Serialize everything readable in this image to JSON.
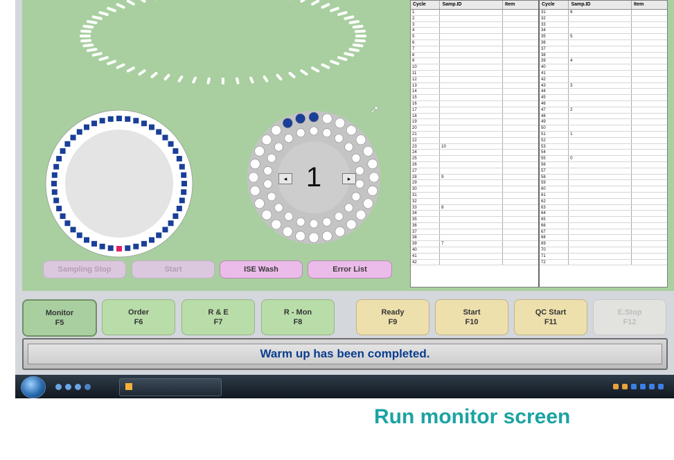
{
  "table": {
    "columns": [
      "Cycle",
      "Samp.ID",
      "Item"
    ],
    "left_rows": [
      [
        "1",
        ""
      ],
      [
        "2",
        ""
      ],
      [
        "3",
        ""
      ],
      [
        "4",
        ""
      ],
      [
        "5",
        ""
      ],
      [
        "6",
        ""
      ],
      [
        "7",
        ""
      ],
      [
        "8",
        ""
      ],
      [
        "9",
        ""
      ],
      [
        "10",
        ""
      ],
      [
        "11",
        ""
      ],
      [
        "12",
        ""
      ],
      [
        "13",
        ""
      ],
      [
        "14",
        ""
      ],
      [
        "15",
        ""
      ],
      [
        "16",
        ""
      ],
      [
        "17",
        ""
      ],
      [
        "18",
        ""
      ],
      [
        "19",
        ""
      ],
      [
        "20",
        ""
      ],
      [
        "21",
        ""
      ],
      [
        "22",
        ""
      ],
      [
        "23",
        "10"
      ],
      [
        "24",
        ""
      ],
      [
        "25",
        ""
      ],
      [
        "26",
        ""
      ],
      [
        "27",
        ""
      ],
      [
        "28",
        "9"
      ],
      [
        "29",
        ""
      ],
      [
        "30",
        ""
      ],
      [
        "31",
        ""
      ],
      [
        "32",
        ""
      ],
      [
        "33",
        "8"
      ],
      [
        "34",
        ""
      ],
      [
        "35",
        ""
      ],
      [
        "36",
        ""
      ],
      [
        "37",
        ""
      ],
      [
        "38",
        ""
      ],
      [
        "39",
        "7"
      ],
      [
        "40",
        ""
      ],
      [
        "41",
        ""
      ],
      [
        "42",
        ""
      ]
    ],
    "right_rows": [
      [
        "31",
        "6"
      ],
      [
        "32",
        ""
      ],
      [
        "33",
        ""
      ],
      [
        "34",
        ""
      ],
      [
        "35",
        "5"
      ],
      [
        "36",
        ""
      ],
      [
        "37",
        ""
      ],
      [
        "38",
        ""
      ],
      [
        "39",
        "4"
      ],
      [
        "40",
        ""
      ],
      [
        "41",
        ""
      ],
      [
        "42",
        ""
      ],
      [
        "43",
        "3"
      ],
      [
        "44",
        ""
      ],
      [
        "45",
        ""
      ],
      [
        "46",
        ""
      ],
      [
        "47",
        "2"
      ],
      [
        "48",
        ""
      ],
      [
        "49",
        ""
      ],
      [
        "50",
        ""
      ],
      [
        "51",
        "1"
      ],
      [
        "52",
        ""
      ],
      [
        "53",
        ""
      ],
      [
        "54",
        ""
      ],
      [
        "55",
        "0"
      ],
      [
        "56",
        ""
      ],
      [
        "57",
        ""
      ],
      [
        "58",
        ""
      ],
      [
        "59",
        ""
      ],
      [
        "60",
        ""
      ],
      [
        "61",
        ""
      ],
      [
        "62",
        ""
      ],
      [
        "63",
        ""
      ],
      [
        "64",
        ""
      ],
      [
        "65",
        ""
      ],
      [
        "66",
        ""
      ],
      [
        "67",
        ""
      ],
      [
        "68",
        ""
      ],
      [
        "69",
        ""
      ],
      [
        "70",
        ""
      ],
      [
        "71",
        ""
      ],
      [
        "72",
        ""
      ]
    ]
  },
  "reagent_disk": {
    "position_number": "1"
  },
  "action_buttons": {
    "sampling_stop": "Sampling Stop",
    "start": "Start",
    "ise_wash": "ISE Wash",
    "error_list": "Error List"
  },
  "function_keys": [
    {
      "label": "Monitor",
      "key": "F5"
    },
    {
      "label": "Order",
      "key": "F6"
    },
    {
      "label": "R & E",
      "key": "F7"
    },
    {
      "label": "R - Mon",
      "key": "F8"
    },
    {
      "label": "Ready",
      "key": "F9"
    },
    {
      "label": "Start",
      "key": "F10"
    },
    {
      "label": "QC Start",
      "key": "F11"
    },
    {
      "label": "E.Stop",
      "key": "F12"
    }
  ],
  "status_message": "Warm up has been completed.",
  "caption": "Run monitor screen",
  "colors": {
    "panel_green": "#a9cfa0",
    "sample_cup_blue": "#1a3f99",
    "sample_cup_red": "#e0206a",
    "status_text_blue": "#0a3d8f",
    "caption_teal": "#1ba3a3"
  },
  "icons": [
    "mouse-cursor-icon",
    "windows-start-icon",
    "rotate-left-icon",
    "rotate-right-icon"
  ]
}
